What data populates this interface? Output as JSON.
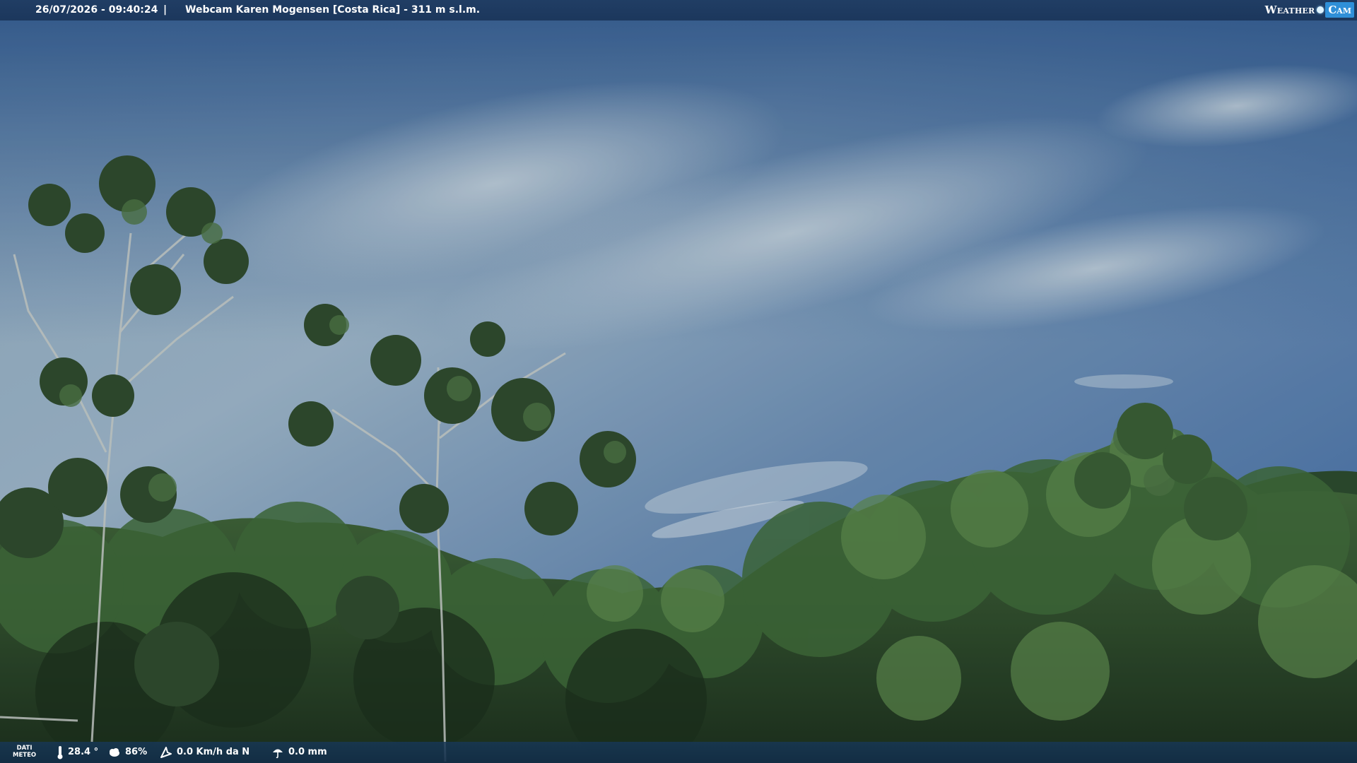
{
  "header": {
    "timestamp": "26/07/2026 - 09:40:24",
    "separator": "|",
    "location": "Webcam Karen Mogensen [Costa Rica]  - 311 m s.l.m.",
    "logo_left": "Weather",
    "logo_right": "Cam"
  },
  "footer": {
    "label_line1": "DATI",
    "label_line2": "METEO",
    "temperature": "28.4 °",
    "humidity": "86%",
    "wind": "0.0 Km/h da N",
    "rain": "0.0 mm"
  },
  "icons": {
    "temperature": "thermometer-icon",
    "humidity": "humidity-cloud-icon",
    "wind": "wind-direction-icon",
    "rain": "rain-umbrella-icon"
  },
  "colors": {
    "sky_top": "#2a548c",
    "sky_light": "#a9bfcf",
    "foliage_dark": "#1f3520",
    "foliage_mid": "#3f6a38",
    "foliage_light": "#6f9a5a",
    "bar": "#1e3a5f"
  }
}
